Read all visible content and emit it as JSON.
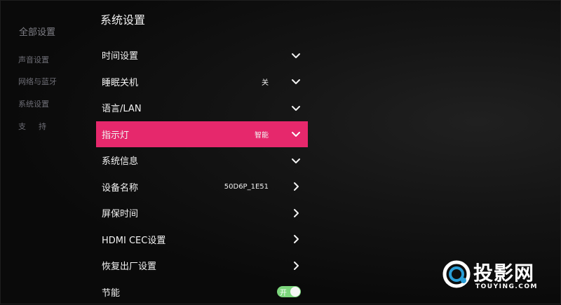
{
  "sidebar": {
    "title": "全部设置",
    "items": [
      {
        "label": "声音设置"
      },
      {
        "label": "网络与蓝牙"
      },
      {
        "label": "系统设置"
      },
      {
        "label": "支持"
      }
    ]
  },
  "header": {
    "title": "系统设置"
  },
  "menu": {
    "rows": [
      {
        "label": "时间设置",
        "value": "",
        "icon": "chevron-down-icon"
      },
      {
        "label": "睡眠关机",
        "value": "关",
        "icon": "chevron-down-icon"
      },
      {
        "label": "语言/LAN",
        "value": "",
        "icon": "chevron-down-icon"
      },
      {
        "label": "指示灯",
        "value": "智能",
        "icon": "chevron-down-icon",
        "selected": true
      },
      {
        "label": "系统信息",
        "value": "",
        "icon": "chevron-down-icon"
      },
      {
        "label": "设备名称",
        "value": "50D6P_1E51",
        "icon": "chevron-right-icon"
      },
      {
        "label": "屏保时间",
        "value": "",
        "icon": "chevron-right-icon"
      },
      {
        "label": "HDMI CEC设置",
        "value": "",
        "icon": "chevron-right-icon"
      },
      {
        "label": "恢复出厂设置",
        "value": "",
        "icon": "chevron-right-icon"
      },
      {
        "label": "节能",
        "toggle": {
          "label": "开",
          "on": true
        }
      }
    ]
  },
  "colors": {
    "selected_row": "#e6286c",
    "toggle_on": "#7cd67c",
    "background": "#0b0b0b"
  },
  "watermark": {
    "name": "投影网",
    "sub": "TOUYING.COM"
  }
}
